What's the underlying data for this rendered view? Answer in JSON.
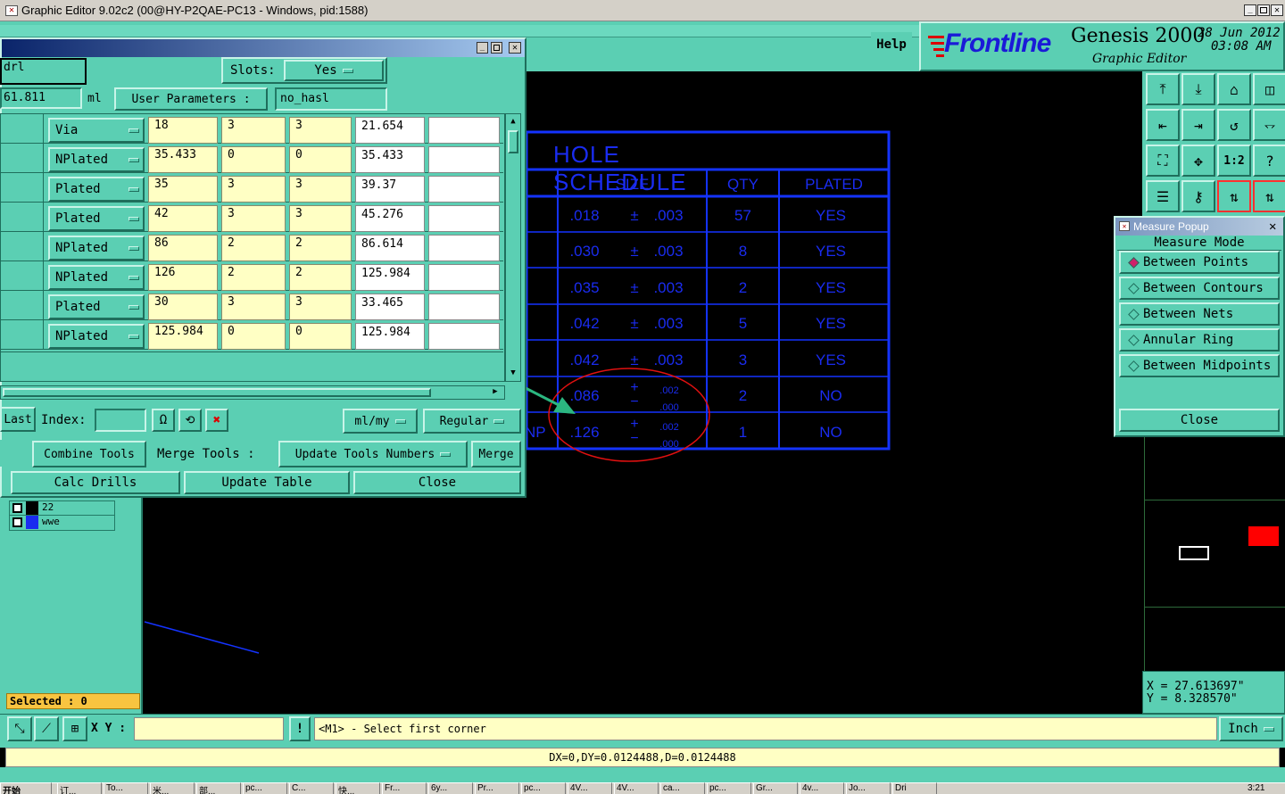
{
  "window": {
    "title": "Graphic Editor 9.02c2 (00@HY-P2QAE-PC13 - Windows, pid:1588)"
  },
  "header": {
    "help": "Help",
    "brand": "Frontline",
    "product": "Genesis 2000",
    "subtitle": "Graphic Editor",
    "date": "28 Jun 2012",
    "time": "03:08 AM"
  },
  "drill": {
    "name": "drl",
    "slots_label": "Slots:",
    "slots_value": "Yes",
    "value": "61.811",
    "unit": "ml",
    "user_params_label": "User Parameters :",
    "user_params_value": "no_hasl",
    "rows": [
      {
        "type": "Via",
        "size": "18",
        "c1": "3",
        "c2": "3",
        "fin": "21.654",
        "extra": ""
      },
      {
        "type": "NPlated",
        "size": "35.433",
        "c1": "0",
        "c2": "0",
        "fin": "35.433",
        "extra": ""
      },
      {
        "type": "Plated",
        "size": "35",
        "c1": "3",
        "c2": "3",
        "fin": "39.37",
        "extra": ""
      },
      {
        "type": "Plated",
        "size": "42",
        "c1": "3",
        "c2": "3",
        "fin": "45.276",
        "extra": ""
      },
      {
        "type": "NPlated",
        "size": "86",
        "c1": "2",
        "c2": "2",
        "fin": "86.614",
        "extra": ""
      },
      {
        "type": "NPlated",
        "size": "126",
        "c1": "2",
        "c2": "2",
        "fin": "125.984",
        "extra": ""
      },
      {
        "type": "Plated",
        "size": "30",
        "c1": "3",
        "c2": "3",
        "fin": "33.465",
        "extra": ""
      },
      {
        "type": "NPlated",
        "size": "125.984",
        "c1": "0",
        "c2": "0",
        "fin": "125.984",
        "extra": ""
      }
    ],
    "last": "Last",
    "index_label": "Index:",
    "index_value": "",
    "units": "ml/my",
    "mode": "Regular",
    "combine": "Combine Tools",
    "merge_tools": "Merge Tools :",
    "update_nums": "Update Tools Numbers",
    "merge": "Merge",
    "calc": "Calc Drills",
    "update_table": "Update Table",
    "close": "Close"
  },
  "layers": [
    {
      "name": "22",
      "color": "#000000"
    },
    {
      "name": "wwe",
      "color": "#1a2cf0"
    }
  ],
  "selected": "Selected : 0",
  "schedule": {
    "title": "HOLE SCHEDULE",
    "headers": [
      "SIZE",
      "QTY",
      "PLATED"
    ],
    "rows": [
      {
        "pre": "",
        "size": ".018",
        "tol": "±",
        "tolv": ".003",
        "tol2": "",
        "qty": "57",
        "plated": "YES"
      },
      {
        "pre": "",
        "size": ".030",
        "tol": "±",
        "tolv": ".003",
        "tol2": "",
        "qty": "8",
        "plated": "YES"
      },
      {
        "pre": "",
        "size": ".035",
        "tol": "±",
        "tolv": ".003",
        "tol2": "",
        "qty": "2",
        "plated": "YES"
      },
      {
        "pre": "",
        "size": ".042",
        "tol": "±",
        "tolv": ".003",
        "tol2": "",
        "qty": "5",
        "plated": "YES"
      },
      {
        "pre": "",
        "size": ".042",
        "tol": "±",
        "tolv": ".003",
        "tol2": "",
        "qty": "3",
        "plated": "YES"
      },
      {
        "pre": "",
        "size": ".086",
        "tol": "+",
        "tolv": ".002",
        "tol2": ".000",
        "qty": "2",
        "plated": "NO"
      },
      {
        "pre": "NP",
        "size": ".126",
        "tol": "+",
        "tolv": ".002",
        "tol2": ".000",
        "qty": "1",
        "plated": "NO"
      }
    ]
  },
  "measure": {
    "title": "Measure Popup",
    "mode_label": "Measure Mode",
    "items": [
      "Between Points",
      "Between Contours",
      "Between Nets",
      "Annular Ring",
      "Between Midpoints"
    ],
    "close": "Close"
  },
  "coords": {
    "x": "X = 27.613697\"",
    "y": "Y = 8.328570\""
  },
  "status": {
    "xy_label": "X Y :",
    "xy_value": "",
    "prompt": "<M1> - Select first corner",
    "unit": "Inch",
    "measure_result": "DX=0,DY=0.0124488,D=0.0124488"
  },
  "taskbar": {
    "start": "开始",
    "items": [
      "订...",
      "To...",
      "米...",
      "部...",
      "pc...",
      "C...",
      "快...",
      "Fr...",
      "6y...",
      "Pr...",
      "pc...",
      "4V...",
      "4V...",
      "ca...",
      "pc...",
      "Gr...",
      "4v...",
      "Jo...",
      "Dri"
    ],
    "clock": "3:21"
  },
  "colors": {
    "accent": "#5bcfb3",
    "schedule": "#1a2cf0",
    "highlight": "#e040d0",
    "annotation": "#e01010"
  }
}
